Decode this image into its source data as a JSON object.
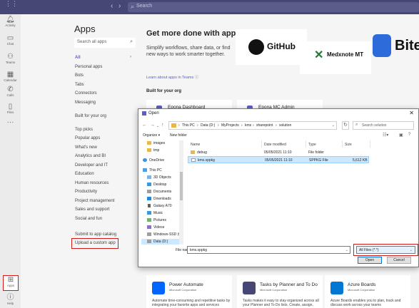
{
  "topbar": {
    "search_placeholder": "Search"
  },
  "rail": [
    {
      "label": "Activity",
      "icon": "bell-icon"
    },
    {
      "label": "Chat",
      "icon": "chat-icon"
    },
    {
      "label": "Teams",
      "icon": "teams-icon"
    },
    {
      "label": "Calendar",
      "icon": "calendar-icon"
    },
    {
      "label": "Calls",
      "icon": "phone-icon"
    },
    {
      "label": "Files",
      "icon": "file-icon"
    },
    {
      "label": "Apps",
      "icon": "apps-icon"
    },
    {
      "label": "Help",
      "icon": "help-icon"
    }
  ],
  "apps": {
    "title": "Apps",
    "search_placeholder": "Search all apps",
    "categories": [
      "All",
      "Personal apps",
      "Bots",
      "Tabs",
      "Connectors",
      "Messaging",
      "Built for your org",
      "Top picks",
      "Popular apps",
      "What's new",
      "Analytics and BI",
      "Developer and IT",
      "Education",
      "Human resources",
      "Productivity",
      "Project management",
      "Sales and support",
      "Social and fun"
    ],
    "submit": "Submit to app catalog",
    "upload": "Upload a custom app"
  },
  "hero": {
    "title": "Get more done with apps!",
    "desc": "Simplify workflows, share data, or find new ways to work smarter together.",
    "link": "Learn about apps in Teams",
    "section": "Built for your org"
  },
  "featured": {
    "github": "GitHub",
    "medxnote": "Medxnote MT",
    "bite": "Bite"
  },
  "org_apps": [
    "Epona Dashboard",
    "Epona MC Admin"
  ],
  "app_cards": [
    {
      "name": "Power Automate",
      "publisher": "Microsoft Corporation",
      "desc": "Automate time-consuming and repetitive tasks by integrating your favorite apps and services",
      "color": "#0066ff"
    },
    {
      "name": "Tasks by Planner and To Do",
      "publisher": "Microsoft Corporation",
      "desc": "Tasks makes it easy to stay organized across all your Planner and To Do lists. Create, assign,",
      "color": "#464775"
    },
    {
      "name": "Azure Boards",
      "publisher": "Microsoft Corporation",
      "desc": "Azure Boards enables you to plan, track and discuss work across your teams",
      "color": "#0078d4"
    }
  ],
  "dialog": {
    "title": "Open",
    "breadcrumb": [
      "This PC",
      "Data (D:)",
      "MyProjects",
      "kms",
      "sharepoint",
      "solution"
    ],
    "search_placeholder": "Search solution",
    "organize": "Organize ▾",
    "new_folder": "New folder",
    "tree": [
      {
        "label": "images",
        "type": "folder",
        "indent": 1
      },
      {
        "label": "tmp",
        "type": "folder",
        "indent": 1
      },
      {
        "label": "OneDrive",
        "type": "cloud",
        "indent": 0
      },
      {
        "label": "This PC",
        "type": "pc",
        "indent": 0
      },
      {
        "label": "3D Objects",
        "type": "obj",
        "indent": 1
      },
      {
        "label": "Desktop",
        "type": "desk",
        "indent": 1
      },
      {
        "label": "Documents",
        "type": "doc",
        "indent": 1
      },
      {
        "label": "Downloads",
        "type": "dl",
        "indent": 1
      },
      {
        "label": "Galaxy A70",
        "type": "phone",
        "indent": 1
      },
      {
        "label": "Music",
        "type": "music",
        "indent": 1
      },
      {
        "label": "Pictures",
        "type": "pic",
        "indent": 1
      },
      {
        "label": "Videos",
        "type": "vid",
        "indent": 1
      },
      {
        "label": "Windows-SSD (C",
        "type": "drive",
        "indent": 1
      },
      {
        "label": "Data (D:)",
        "type": "drive",
        "indent": 1
      }
    ],
    "columns": [
      "Name",
      "Date modified",
      "Type",
      "Size"
    ],
    "files": [
      {
        "name": "debug",
        "date": "05/05/2021 11:10",
        "type": "File folder",
        "size": "",
        "kind": "folder"
      },
      {
        "name": "kms.sppkg",
        "date": "05/05/2021 11:10",
        "type": "SPPKG File",
        "size": "5,612 KB",
        "kind": "file"
      }
    ],
    "filename_label": "File name:",
    "filename_value": "kms.sppkg",
    "filter": "All Files (*.*)",
    "open": "Open",
    "cancel": "Cancel"
  }
}
